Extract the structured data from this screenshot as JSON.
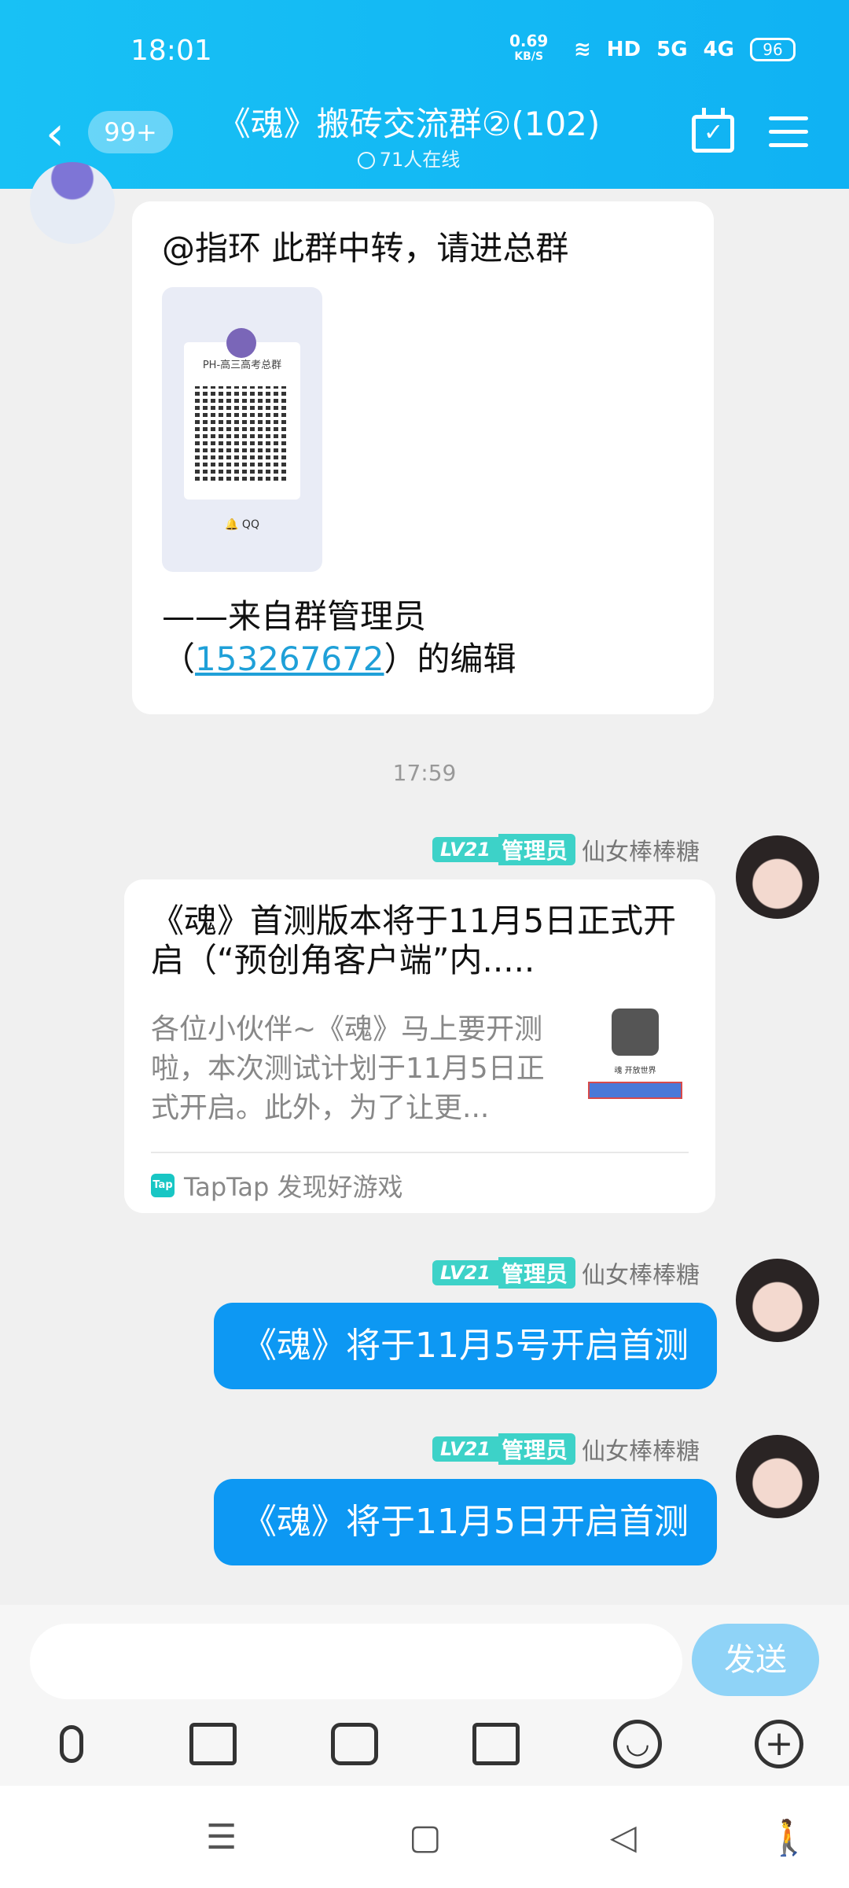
{
  "status_bar": {
    "time": "18:01",
    "net_speed": "0.69",
    "net_unit": "KB/S",
    "hd": "HD",
    "sig1": "5G",
    "sig2": "4G",
    "battery": "96"
  },
  "header": {
    "unread_badge": "99+",
    "title": "《魂》搬砖交流群②(102)",
    "online": "71人在线"
  },
  "messages": {
    "m1": {
      "text1": "@指环 此群中转，请进总群",
      "qr_group_name": "PH-高三高考总群",
      "qr_footer": "QQ",
      "text2_a": "——来自群管理员",
      "text2_open": "（",
      "link": "153267672",
      "text2_close": "）的编辑"
    },
    "timestamp": "17:59",
    "sender": {
      "level": "LV21",
      "role": "管理员",
      "name": "仙女棒棒糖"
    },
    "card": {
      "title": "《魂》首测版本将于11月5日正式开启（“预创角客户端”内.....",
      "desc": "各位小伙伴~《魂》马上要开测啦，本次测试计划于11月5日正式开启。此外，为了让更...",
      "thumb_label": "魂 开放世界",
      "source": "TapTap 发现好游戏",
      "source_icon": "Tap"
    },
    "m3": "《魂》将于11月5号开启首测",
    "m4": "《魂》将于11月5日开启首测"
  },
  "composer": {
    "placeholder": "",
    "send_label": "发送"
  }
}
